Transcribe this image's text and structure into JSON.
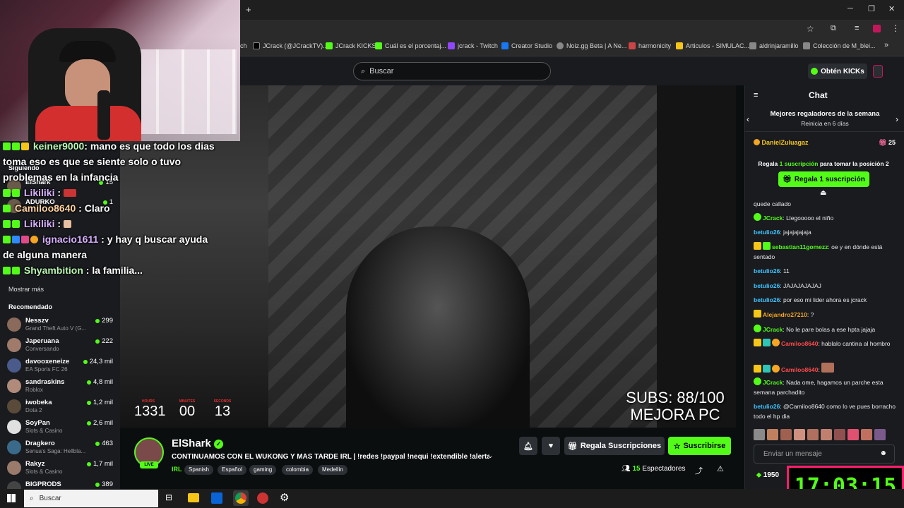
{
  "browser": {
    "new_tab": "+",
    "bookmarks": [
      {
        "label": "ch",
        "color": "#444"
      },
      {
        "label": "JCrack (@JCrackTV)...",
        "color": "#000"
      },
      {
        "label": "JCrack KICKS",
        "color": "#53fc18"
      },
      {
        "label": "Cuál es el porcentaj...",
        "color": "#53fc18"
      },
      {
        "label": "jcrack - Twitch",
        "color": "#9146ff"
      },
      {
        "label": "Creator Studio",
        "color": "#1877f2"
      },
      {
        "label": "Noiz.gg Beta | A Ne...",
        "color": "#888"
      },
      {
        "label": "harmonicity",
        "color": "#c44"
      },
      {
        "label": "Articulos - SIMULAC...",
        "color": "#f5c518"
      },
      {
        "label": "aldrinjaramillo",
        "color": "#888"
      },
      {
        "label": "Colección de M_blei...",
        "color": "#888"
      }
    ],
    "more": "»"
  },
  "header": {
    "search_placeholder": "Buscar",
    "get_kicks": "Obtén KICKs"
  },
  "sidebar": {
    "following_title": "Siguiendo",
    "following": [
      {
        "name": "ElShark",
        "viewers": "15"
      },
      {
        "name": "ADURKO",
        "viewers": "1"
      }
    ],
    "show_more": "Mostrar más",
    "recommended_title": "Recomendado",
    "recommended": [
      {
        "name": "Nesszv",
        "category": "Grand Theft Auto V (G...",
        "viewers": "299"
      },
      {
        "name": "Japeruana",
        "category": "Conversando",
        "viewers": "222"
      },
      {
        "name": "davooxeneize",
        "category": "EA Sports FC 26",
        "viewers": "24,3 mil"
      },
      {
        "name": "sandraskins",
        "category": "Roblox",
        "viewers": "4,8 mil"
      },
      {
        "name": "iwobeka",
        "category": "Dota 2",
        "viewers": "1,2 mil"
      },
      {
        "name": "SoyPan",
        "category": "Slots & Casino",
        "viewers": "2,6 mil"
      },
      {
        "name": "Dragkero",
        "category": "Senua's Saga: Hellbla...",
        "viewers": "463"
      },
      {
        "name": "Rakyz",
        "category": "Slots & Casino",
        "viewers": "1,7 mil"
      },
      {
        "name": "BIGPRODS",
        "category": "",
        "viewers": "389"
      }
    ]
  },
  "overlay_chat": [
    {
      "user": "keiner9000",
      "text": ": mano es que todo los dias toma eso es que se siente solo o tuvo problemas en la infancia"
    },
    {
      "user": "Likiliki",
      "text": ":"
    },
    {
      "user": "Camiloo8640",
      "text": ": Claro"
    },
    {
      "user": "Likiliki",
      "text": ":"
    },
    {
      "user": "ignacio1611",
      "text": ": y hay q buscar ayuda de alguna manera"
    },
    {
      "user": "Shyambition",
      "text": ": la familia..."
    }
  ],
  "video_overlay": {
    "subs_line1": "SUBS: 88/100",
    "subs_line2": "MEJORA PC",
    "timer": [
      {
        "label": "HOURS",
        "value": "1331"
      },
      {
        "label": "MINUTES",
        "value": "00"
      },
      {
        "label": "SECONDS",
        "value": "13"
      }
    ]
  },
  "stream": {
    "channel": "ElShark",
    "live": "LIVE",
    "title": "CONTINUAMOS CON EL WUKONG Y MÁS TARDE IRL | !redes !paypal !nequi !extendible !alertas...",
    "category": "IRL",
    "tags": [
      "Spanish",
      "Español",
      "gaming",
      "colombia",
      "Medellin"
    ],
    "gift_subs": "Regala Suscripciones",
    "subscribe": "Suscribirse",
    "viewers": "15",
    "viewers_label": "Espectadores"
  },
  "chat": {
    "title": "Chat",
    "leaderboard_title": "Mejores regaladores de la semana",
    "leaderboard_sub": "Reinicia en 6 días",
    "top_gifter": "DanielZuluagaz",
    "top_gifter_count": "25",
    "gift_prompt_a": "Regala",
    "gift_prompt_b": "1 suscripción",
    "gift_prompt_c": "para tomar la posición 2",
    "gift_button": "Regala 1 suscripción",
    "messages": [
      {
        "user": "",
        "text": "quede callado",
        "color": "#e8e8e8"
      },
      {
        "user": "JCrack",
        "text": ": Llegooooo el niño",
        "color": "#53fc18"
      },
      {
        "user": "betulio26",
        "text": ": jajajajajaja",
        "color": "#3ec4ff"
      },
      {
        "user": "sebastian11gomezz",
        "text": ": oe y en dónde está sentado",
        "color": "#53fc18"
      },
      {
        "user": "betulio26",
        "text": ": 11",
        "color": "#3ec4ff"
      },
      {
        "user": "betulio26",
        "text": ": JAJAJAJAJAJ",
        "color": "#3ec4ff"
      },
      {
        "user": "betulio26",
        "text": ": por eso mi lider ahora es jcrack",
        "color": "#3ec4ff"
      },
      {
        "user": "Alejandro27210",
        "text": ": ?",
        "color": "#f5a623"
      },
      {
        "user": "JCrack",
        "text": ": No le pare bolas a ese hpta jajaja",
        "color": "#53fc18"
      },
      {
        "user": "Camiloo8640",
        "text": ": hablalo cantina al hombro",
        "color": "#ff4a4a"
      },
      {
        "user": "Camiloo8640",
        "text": ":",
        "color": "#ff4a4a"
      },
      {
        "user": "JCrack",
        "text": ": Nada ome, hagamos un parche esta semana parchadito",
        "color": "#53fc18"
      },
      {
        "user": "betulio26",
        "text": ": @Camiloo8640 como lo ve pues borracho todo el hp dia",
        "color": "#3ec4ff"
      }
    ],
    "input_placeholder": "Enviar un mensaje",
    "points": "1950"
  },
  "taskbar": {
    "search": "Buscar"
  },
  "clock_overlay": "17:03:15"
}
